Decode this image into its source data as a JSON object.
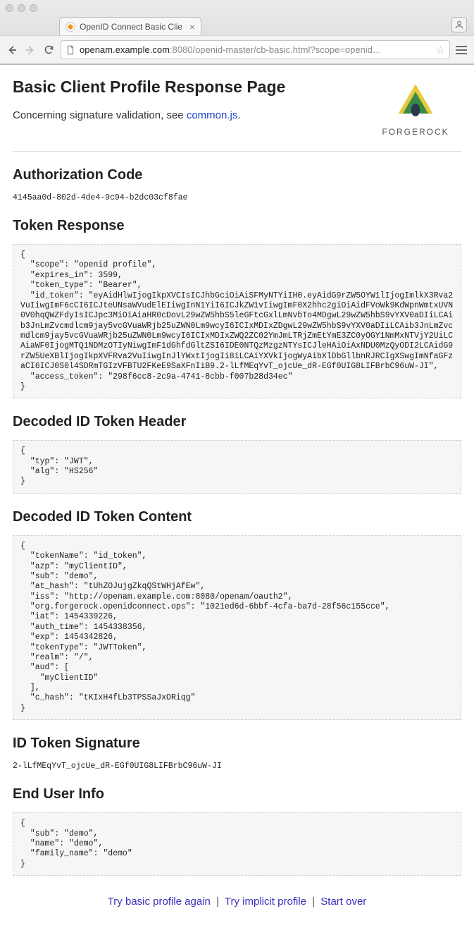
{
  "browser": {
    "tab_title": "OpenID Connect Basic Clie",
    "url_host": "openam.example.com",
    "url_port": ":8080",
    "url_path": "/openid-master/cb-basic.html?scope=openid…"
  },
  "page": {
    "title": "Basic Client Profile Response Page",
    "subtitle_prefix": "Concerning signature validation, see ",
    "subtitle_link": "common.js",
    "subtitle_suffix": ".",
    "logo_text": "FORGEROCK"
  },
  "sections": {
    "auth_code": {
      "heading": "Authorization Code",
      "value": "4145aa0d-802d-4de4-9c94-b2dc03cf8fae"
    },
    "token_response": {
      "heading": "Token Response",
      "body": "{\n  \"scope\": \"openid profile\",\n  \"expires_in\": 3599,\n  \"token_type\": \"Bearer\",\n  \"id_token\": \"eyAidHlwIjogIkpXVCIsICJhbGciOiAiSFMyNTYiIH0.eyAidG9rZW5OYW1lIjogImlkX3Rva2VuIiwgImF6cCI6ICJteUNsaWVudElEIiwgInN1YiI6ICJkZW1vIiwgImF0X2hhc2giOiAidFVoWk9KdWpnWmtxUVN0V0hqQWZFdyIsICJpc3MiOiAiaHR0cDovL29wZW5hbS5leGFtcGxlLmNvbTo4MDgwL29wZW5hbS9vYXV0aDIiLCAib3JnLmZvcmdlcm9jay5vcGVuaWRjb25uZWN0Lm9wcyI6ICIxMDIxZDgwL29wZW5hbS9vYXV0aDIiLCAib3JnLmZvcmdlcm9jay5vcGVuaWRjb25uZWN0Lm9wcyI6ICIxMDIxZWQ2ZC02YmJmLTRjZmEtYmE3ZC0yOGY1NmMxNTVjY2UiLCAiaWF0IjogMTQ1NDMzOTIyNiwgImF1dGhfdGltZSI6IDE0NTQzMzgzNTYsICJleHAiOiAxNDU0MzQyODI2LCAidG9rZW5UeXBlIjogIkpXVFRva2VuIiwgInJlYWxtIjogIi8iLCAiYXVkIjogWyAibXlDbGllbnRJRCIgXSwgImNfaGFzaCI6ICJ0S0l4SDRmTGIzVFBTU2FKeE9SaXFnIiB9.2-lLfMEqYvT_ojcUe_dR-EGf0UIG8LIFBrbC96uW-JI\",\n  \"access_token\": \"298f6cc8-2c9a-4741-8cbb-f007b28d34ec\"\n}"
    },
    "decoded_header": {
      "heading": "Decoded ID Token Header",
      "body": "{\n  \"typ\": \"JWT\",\n  \"alg\": \"HS256\"\n}"
    },
    "decoded_content": {
      "heading": "Decoded ID Token Content",
      "body": "{\n  \"tokenName\": \"id_token\",\n  \"azp\": \"myClientID\",\n  \"sub\": \"demo\",\n  \"at_hash\": \"tUhZOJujgZkqQStWHjAfEw\",\n  \"iss\": \"http://openam.example.com:8080/openam/oauth2\",\n  \"org.forgerock.openidconnect.ops\": \"1021ed6d-6bbf-4cfa-ba7d-28f56c155cce\",\n  \"iat\": 1454339226,\n  \"auth_time\": 1454338356,\n  \"exp\": 1454342826,\n  \"tokenType\": \"JWTToken\",\n  \"realm\": \"/\",\n  \"aud\": [\n    \"myClientID\"\n  ],\n  \"c_hash\": \"tKIxH4fLb3TPSSaJxORiqg\"\n}"
    },
    "signature": {
      "heading": "ID Token Signature",
      "value": "2-lLfMEqYvT_ojcUe_dR-EGf0UIG8LIFBrbC96uW-JI"
    },
    "end_user": {
      "heading": "End User Info",
      "body": "{\n  \"sub\": \"demo\",\n  \"name\": \"demo\",\n  \"family_name\": \"demo\"\n}"
    }
  },
  "footer": {
    "basic": "Try basic profile again",
    "implicit": "Try implicit profile",
    "start_over": "Start over"
  }
}
